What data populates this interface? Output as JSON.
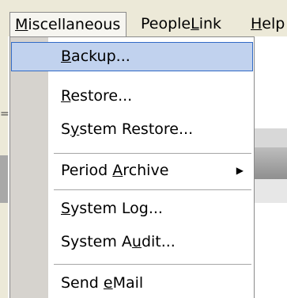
{
  "menubar": {
    "items": [
      {
        "pre": "",
        "key": "M",
        "post": "iscellaneous"
      },
      {
        "pre": "People",
        "key": "L",
        "post": "ink"
      },
      {
        "pre": "",
        "key": "H",
        "post": "elp"
      }
    ]
  },
  "menu": {
    "items": [
      {
        "pre": "",
        "key": "B",
        "post": "ackup..."
      },
      {
        "pre": "",
        "key": "R",
        "post": "estore..."
      },
      {
        "pre": "S",
        "key": "y",
        "post": "stem Restore..."
      },
      {
        "pre": "Period ",
        "key": "A",
        "post": "rchive",
        "submenu_icon": "triangle-right-icon"
      },
      {
        "pre": "",
        "key": "S",
        "post": "ystem Log..."
      },
      {
        "pre": "System A",
        "key": "u",
        "post": "dit..."
      },
      {
        "pre": "Send ",
        "key": "e",
        "post": "Mail"
      }
    ]
  },
  "background": {
    "left_glyph": "="
  }
}
